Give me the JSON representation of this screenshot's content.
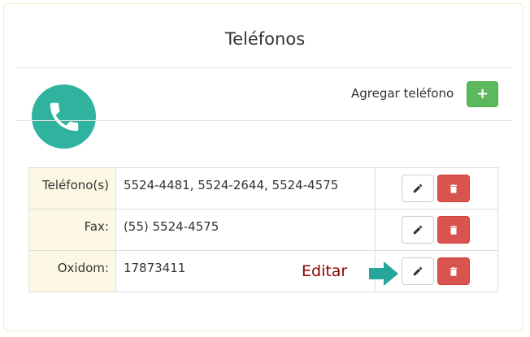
{
  "header": {
    "title": "Teléfonos"
  },
  "toolbar": {
    "add_label": "Agregar teléfono",
    "add_symbol": "+"
  },
  "rows": [
    {
      "label": "Teléfono(s)",
      "value": "5524-4481, 5524-2644, 5524-4575"
    },
    {
      "label": "Fax:",
      "value": "(55) 5524-4575"
    },
    {
      "label": "Oxidom:",
      "value": "17873411"
    }
  ],
  "annotation": {
    "text": "Editar"
  },
  "colors": {
    "accent_teal": "#2fb39f",
    "add_green": "#5cb85c",
    "delete_red": "#d9534f",
    "label_bg": "#fcf8e3",
    "annotation_text": "#8b0000"
  },
  "icons": [
    "phone-icon",
    "plus-icon",
    "pencil-icon",
    "trash-icon",
    "arrow-right-icon"
  ]
}
